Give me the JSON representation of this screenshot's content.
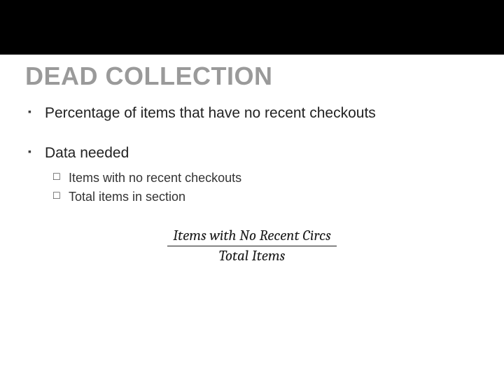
{
  "title": "DEAD COLLECTION",
  "bullets": [
    {
      "text": "Percentage of items that have no recent checkouts"
    },
    {
      "text": "Data needed",
      "sub": [
        "Items with no recent checkouts",
        "Total items in section"
      ]
    }
  ],
  "formula": {
    "numerator": "Items with No Recent Circs",
    "denominator": "Total Items"
  }
}
